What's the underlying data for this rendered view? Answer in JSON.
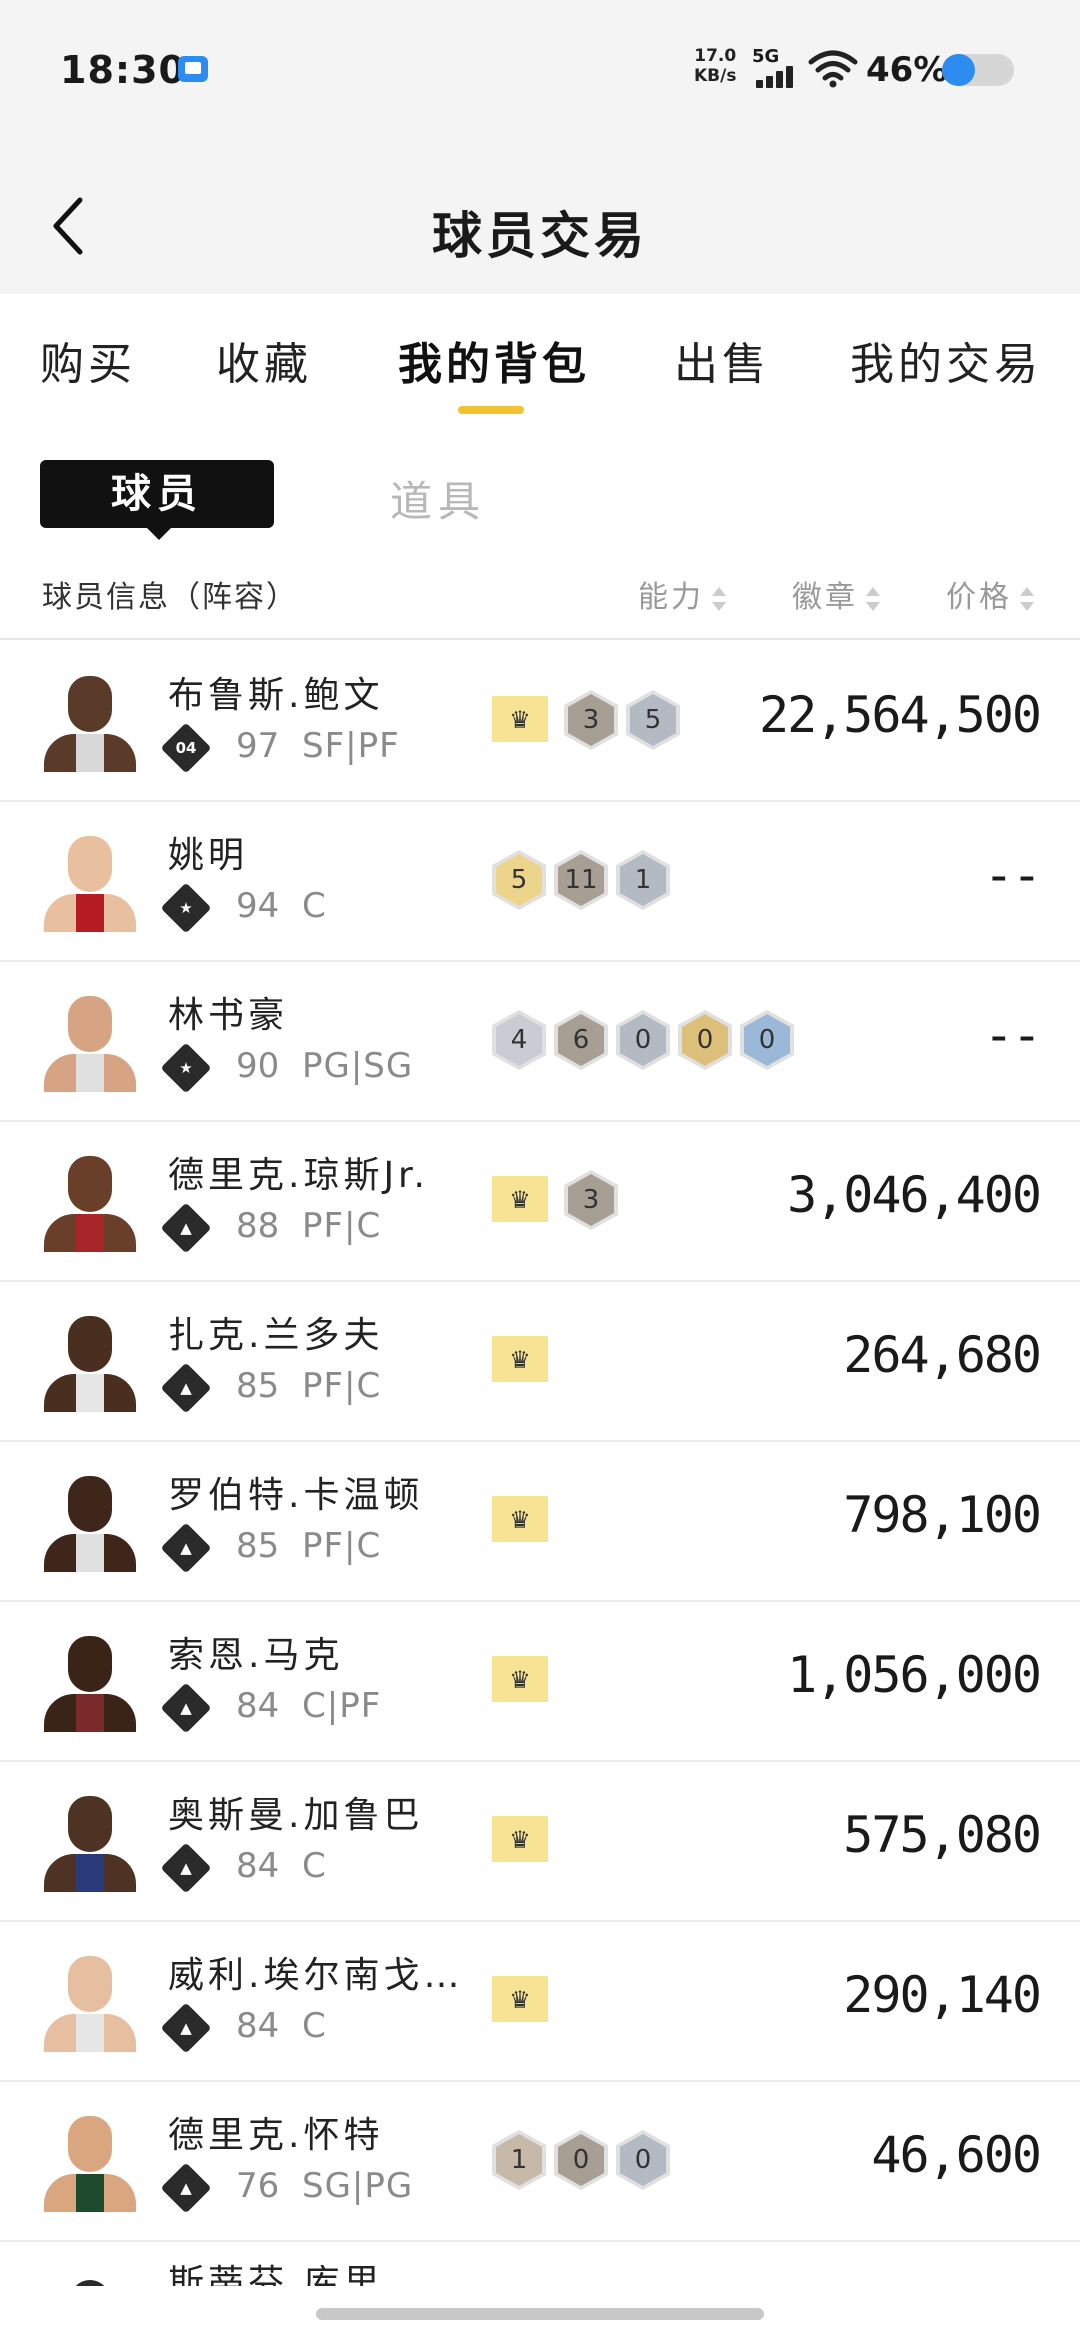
{
  "status_bar": {
    "time": "18:30",
    "net_speed_value": "17.0",
    "net_speed_unit": "KB/s",
    "signal_label": "5G",
    "battery_pct_text": "46%",
    "battery_level": 0.46
  },
  "nav": {
    "title": "球员交易"
  },
  "tabs": [
    "购买",
    "收藏",
    "我的背包",
    "出售",
    "我的交易"
  ],
  "active_tab": "我的背包",
  "subtabs": {
    "active": "球员",
    "inactive": "道具"
  },
  "columns": {
    "info": "球员信息（阵容）",
    "ability": "能力",
    "badge": "徽章",
    "price": "价格"
  },
  "players": [
    {
      "name": "布鲁斯.鲍文",
      "tier": "04",
      "rating": "97",
      "pos": "SF|PF",
      "price": "22,564,500",
      "badges": [
        {
          "kind": "crown"
        },
        {
          "kind": "hex",
          "value": "3",
          "color": "#a79e94"
        },
        {
          "kind": "hex",
          "value": "5",
          "color": "#b4bac4"
        }
      ]
    },
    {
      "name": "姚明",
      "tier": "★",
      "rating": "94",
      "pos": "C",
      "price": "--",
      "badges": [
        {
          "kind": "hex",
          "value": "5",
          "color": "#ecd58a"
        },
        {
          "kind": "hex",
          "value": "11",
          "color": "#a79e94"
        },
        {
          "kind": "hex",
          "value": "1",
          "color": "#b4bac4"
        }
      ]
    },
    {
      "name": "林书豪",
      "tier": "★",
      "rating": "90",
      "pos": "PG|SG",
      "price": "--",
      "badges": [
        {
          "kind": "hex",
          "value": "4",
          "color": "#c9ccd2"
        },
        {
          "kind": "hex",
          "value": "6",
          "color": "#a79e94"
        },
        {
          "kind": "hex",
          "value": "0",
          "color": "#b4bac4"
        },
        {
          "kind": "hex",
          "value": "0",
          "color": "#dcc07a"
        },
        {
          "kind": "hex",
          "value": "0",
          "color": "#9cb8d8"
        }
      ]
    },
    {
      "name": "德里克.琼斯Jr.",
      "tier": "▲",
      "rating": "88",
      "pos": "PF|C",
      "price": "3,046,400",
      "badges": [
        {
          "kind": "crown"
        },
        {
          "kind": "hex",
          "value": "3",
          "color": "#a79e94"
        }
      ]
    },
    {
      "name": "扎克.兰多夫",
      "tier": "▲",
      "rating": "85",
      "pos": "PF|C",
      "price": "264,680",
      "badges": [
        {
          "kind": "crown"
        }
      ]
    },
    {
      "name": "罗伯特.卡温顿",
      "tier": "▲",
      "rating": "85",
      "pos": "PF|C",
      "price": "798,100",
      "badges": [
        {
          "kind": "crown"
        }
      ]
    },
    {
      "name": "索恩.马克",
      "tier": "▲",
      "rating": "84",
      "pos": "C|PF",
      "price": "1,056,000",
      "badges": [
        {
          "kind": "crown"
        }
      ]
    },
    {
      "name": "奥斯曼.加鲁巴",
      "tier": "▲",
      "rating": "84",
      "pos": "C",
      "price": "575,080",
      "badges": [
        {
          "kind": "crown"
        }
      ]
    },
    {
      "name": "威利.埃尔南戈…",
      "tier": "▲",
      "rating": "84",
      "pos": "C",
      "price": "290,140",
      "badges": [
        {
          "kind": "crown"
        }
      ]
    },
    {
      "name": "德里克.怀特",
      "tier": "▲",
      "rating": "76",
      "pos": "SG|PG",
      "price": "46,600",
      "badges": [
        {
          "kind": "hex",
          "value": "1",
          "color": "#c7b9a8"
        },
        {
          "kind": "hex",
          "value": "0",
          "color": "#a79e94"
        },
        {
          "kind": "hex",
          "value": "0",
          "color": "#b4bac4"
        }
      ]
    }
  ],
  "partial_row_name": "斯蒂芬.库里",
  "colors": {
    "accent": "#f2c230",
    "crown_bg": "#f6e394",
    "tier_bg": "#2a2a2a"
  }
}
